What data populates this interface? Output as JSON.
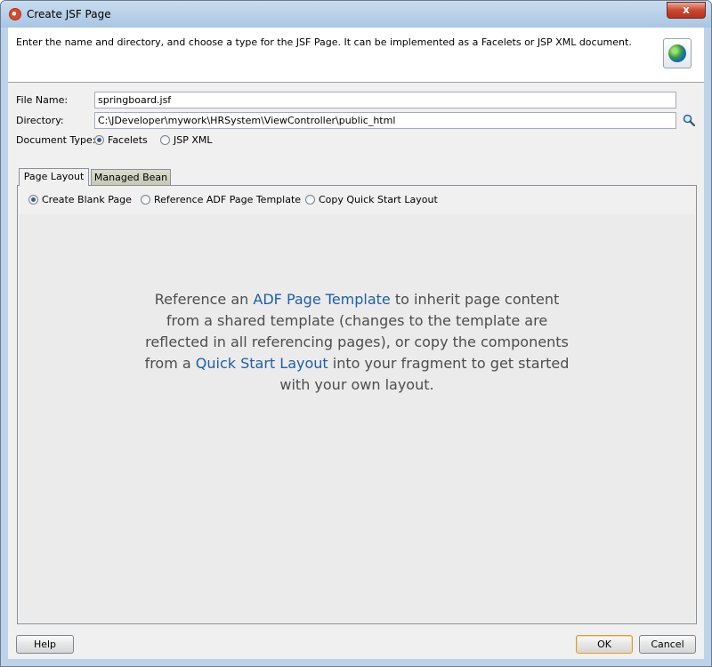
{
  "window": {
    "title": "Create JSF Page",
    "close_label": "x"
  },
  "header": {
    "description": "Enter the name and directory, and choose a type for the JSF Page. It can be implemented as a Facelets or JSP XML document.",
    "icon": "globe-icon"
  },
  "form": {
    "file_name_label": "File Name:",
    "file_name_value": "springboard.jsf",
    "directory_label": "Directory:",
    "directory_value": "C:\\JDeveloper\\mywork\\HRSystem\\ViewController\\public_html",
    "document_type_label": "Document Type:",
    "document_types": [
      {
        "label": "Facelets",
        "selected": true
      },
      {
        "label": "JSP XML",
        "selected": false
      }
    ]
  },
  "tabs": [
    {
      "label": "Page Layout",
      "active": true
    },
    {
      "label": "Managed Bean",
      "active": false
    }
  ],
  "page_layout": {
    "options": [
      {
        "label": "Create Blank Page",
        "selected": true
      },
      {
        "label": "Reference ADF Page Template",
        "selected": false
      },
      {
        "label": "Copy Quick Start Layout",
        "selected": false
      }
    ],
    "info": {
      "part1": "Reference an ",
      "link1": "ADF Page Template",
      "part2": " to inherit page content from a shared template (changes to the template are reflected in all referencing pages), or copy the components from a ",
      "link2": "Quick Start Layout",
      "part3": " into your fragment to get started with your own layout."
    }
  },
  "footer": {
    "help_label": "Help",
    "ok_label": "OK",
    "cancel_label": "Cancel"
  },
  "colors": {
    "link": "#1e5fa8",
    "info_text": "#4d4d4d",
    "titlebar": "#bcd3ea"
  }
}
